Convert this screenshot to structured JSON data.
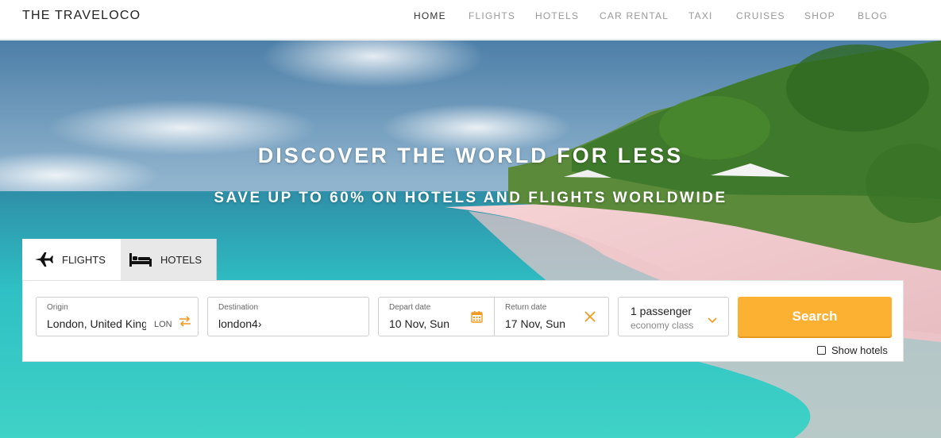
{
  "brand": "THE TRAVELOCO",
  "nav": {
    "home": "HOME",
    "flights": "FLIGHTS",
    "hotels": "HOTELS",
    "car_rental": "CAR RENTAL",
    "taxi": "TAXI",
    "cruises": "CRUISES",
    "shop": "SHOP",
    "blog": "BLOG",
    "active": "HOME"
  },
  "hero": {
    "headline": "DISCOVER THE WORLD FOR LESS",
    "subheadline": "SAVE UP TO 60% ON HOTELS AND FLIGHTS WORLDWIDE"
  },
  "tabs": {
    "flights": "FLIGHTS",
    "hotels": "HOTELS",
    "selected": "FLIGHTS"
  },
  "search": {
    "origin_label": "Origin",
    "origin_value": "London, United Kingdom",
    "origin_code": "LON",
    "destination_label": "Destination",
    "destination_value": "london4›",
    "depart_label": "Depart date",
    "depart_value": "10 Nov, Sun",
    "return_label": "Return date",
    "return_value": "17 Nov, Sun",
    "passengers": "1 passenger",
    "cabin_class": "economy class",
    "button": "Search",
    "show_hotels_label": "Show hotels",
    "show_hotels_checked": false
  },
  "icons": {
    "swap": "swap-arrows-icon",
    "calendar": "calendar-icon",
    "clear": "close-icon",
    "dropdown": "chevron-down-icon",
    "flight_tab": "airplane-icon",
    "hotel_tab": "bed-icon"
  },
  "colors": {
    "accent": "#fdb133",
    "nav_active": "#333333",
    "nav_inactive": "#999999"
  }
}
